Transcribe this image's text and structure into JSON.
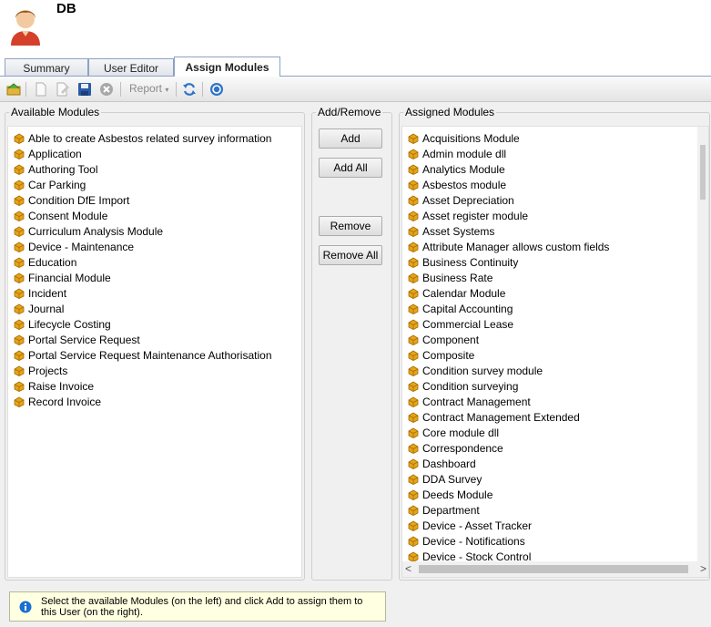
{
  "user": {
    "name": "DB",
    "avatar_icon": "user-avatar-icon"
  },
  "tabs": [
    {
      "label": "Summary",
      "active": false
    },
    {
      "label": "User Editor",
      "active": false
    },
    {
      "label": "Assign Modules",
      "active": true
    }
  ],
  "toolbar": {
    "report_label": "Report",
    "icons": [
      "home-folder-icon",
      "new-document-icon",
      "edit-document-icon",
      "save-icon",
      "delete-icon",
      "report-dropdown-icon",
      "refresh-icon",
      "help-icon"
    ]
  },
  "available": {
    "title": "Available Modules",
    "items": [
      "Able to create Asbestos related survey information",
      "Application",
      "Authoring Tool",
      "Car Parking",
      "Condition DfE Import",
      "Consent Module",
      "Curriculum Analysis Module",
      "Device - Maintenance",
      "Education",
      "Financial Module",
      "Incident",
      "Journal",
      "Lifecycle Costing",
      "Portal Service Request",
      "Portal Service Request Maintenance Authorisation",
      "Projects",
      "Raise Invoice",
      "Record Invoice"
    ]
  },
  "actions": {
    "title": "Add/Remove",
    "add": "Add",
    "add_all": "Add All",
    "remove": "Remove",
    "remove_all": "Remove All"
  },
  "assigned": {
    "title": "Assigned Modules",
    "items": [
      "Acquisitions Module",
      "Admin module dll",
      "Analytics Module",
      "Asbestos module",
      "Asset Depreciation",
      "Asset register module",
      "Asset Systems",
      "Attribute Manager allows custom fields",
      "Business Continuity",
      "Business Rate",
      "Calendar Module",
      "Capital Accounting",
      "Commercial Lease",
      "Component",
      "Composite",
      "Condition survey module",
      "Condition surveying",
      "Contract Management",
      "Contract Management Extended",
      "Core module dll",
      "Correspondence",
      "Dashboard",
      "DDA Survey",
      "Deeds Module",
      "Department",
      "Device - Asset Tracker",
      "Device - Notifications",
      "Device - Stock Control"
    ]
  },
  "hint": {
    "text": "Select the available Modules (on the left) and click Add to assign them to this User (on the right).",
    "icon": "info-icon"
  },
  "colors": {
    "module_icon": "#e8a317",
    "info_icon": "#1a6fd0",
    "tab_border": "#8da2c4"
  }
}
